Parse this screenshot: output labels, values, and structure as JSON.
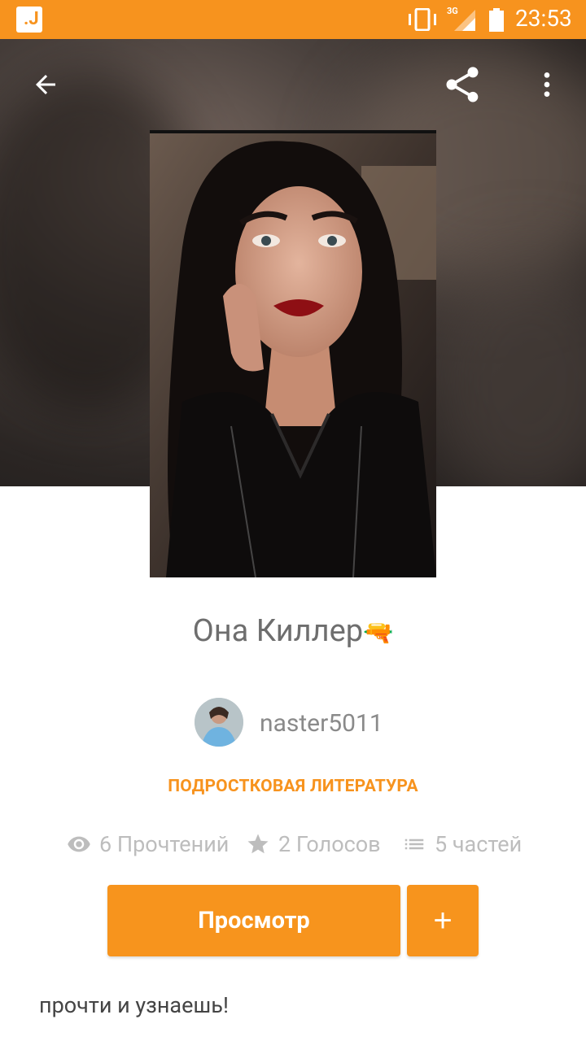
{
  "status_bar": {
    "time": "23:53",
    "network": "3G",
    "app_icon": "wattpad-like-app-icon"
  },
  "header": {
    "back_icon": "back-arrow-icon",
    "share_icon": "share-icon",
    "more_icon": "more-vert-icon"
  },
  "story": {
    "title": "Она Киллер",
    "title_emoji": "🔫",
    "author": "naster5011",
    "genre": "ПОДРОСТКОВАЯ ЛИТЕРАТУРА",
    "reads": "6 Прочтений",
    "votes": "2 Голосов",
    "parts": "5 частей",
    "description": "прочти и узнаешь!"
  },
  "actions": {
    "view_label": "Просмотр",
    "add_label": "+"
  },
  "colors": {
    "accent": "#f7931e",
    "title_text": "#6e6e6e",
    "stats_text": "#bdbdbd"
  }
}
